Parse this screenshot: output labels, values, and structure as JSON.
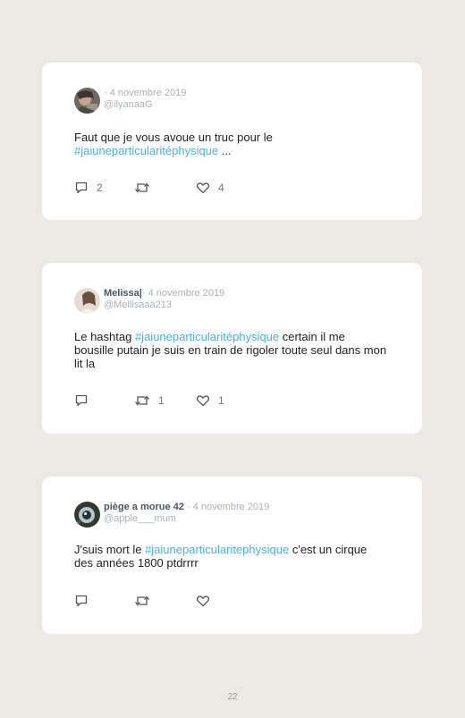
{
  "tweets": [
    {
      "display_name": "",
      "separator": "·",
      "date": "4 novembre 2019",
      "handle": "@ilyanaaG",
      "text_before": "Faut que je vous avoue un truc pour le ",
      "hashtag": "#jaiuneparticularitéphysique",
      "text_after": " ...",
      "replies": "2",
      "retweets": "",
      "likes": "4"
    },
    {
      "display_name": "Melissa|",
      "separator": "·",
      "date": "4 novembre 2019",
      "handle": "@Mellisaaa213",
      "text_before": "Le hashtag ",
      "hashtag": "#jaiuneparticularitéphysique",
      "text_after": " certain il me bousille putain je suis en train de rigoler toute seul dans mon lit la",
      "replies": "",
      "retweets": "1",
      "likes": "1"
    },
    {
      "display_name": "piège a morue 42",
      "separator": "·",
      "date": "4 novembre 2019",
      "handle": "@apple___mum",
      "text_before": "J'suis mort le ",
      "hashtag": "#jaiuneparticularitephysique",
      "text_after": " c'est un cirque des années 1800 ptdrrrr",
      "replies": "",
      "retweets": "",
      "likes": ""
    }
  ],
  "page_number": "22",
  "colors": {
    "background": "#ece9e4",
    "card": "#ffffff",
    "hashtag": "#4ab3e2",
    "muted": "#a9b2ba"
  },
  "icons": [
    "comment-icon",
    "retweet-icon",
    "heart-icon"
  ]
}
